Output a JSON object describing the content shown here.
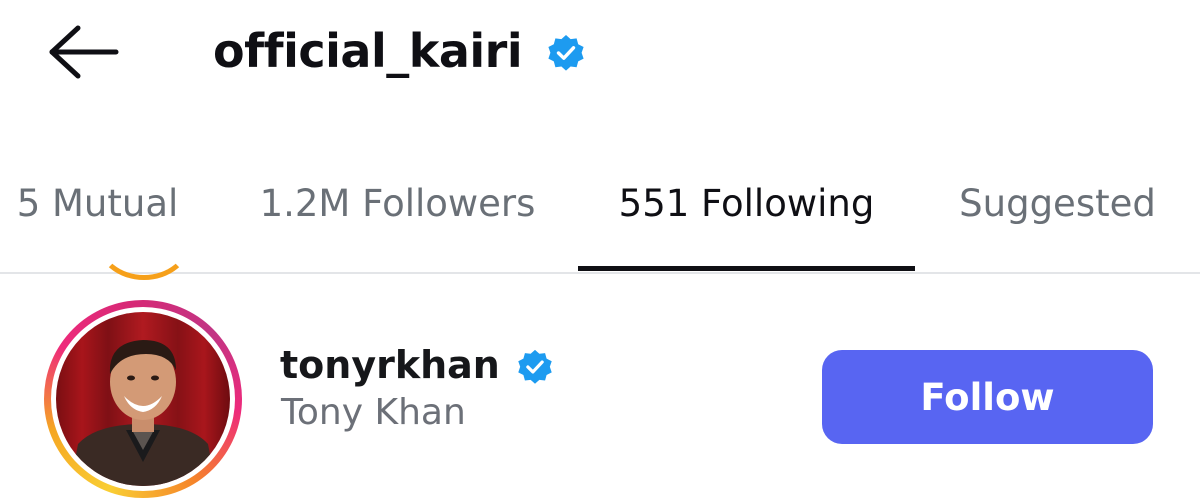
{
  "header": {
    "title": "official_kairi",
    "back_icon": "arrow-left-icon",
    "verified_icon": "verified-badge-icon"
  },
  "tabs": [
    {
      "label": "5 Mutual",
      "active": false
    },
    {
      "label": "1.2M Followers",
      "active": false
    },
    {
      "label": "551 Following",
      "active": true
    },
    {
      "label": "Suggested",
      "active": false
    }
  ],
  "list": {
    "items": [
      {
        "username": "tonyrkhan",
        "full_name": "Tony Khan",
        "verified": true,
        "follow_label": "Follow"
      }
    ]
  },
  "colors": {
    "verified_blue": "#1d9bf0",
    "follow_button": "#5865f2",
    "active_tab_text": "#0f0f14",
    "inactive_tab_text": "#6a7077"
  }
}
